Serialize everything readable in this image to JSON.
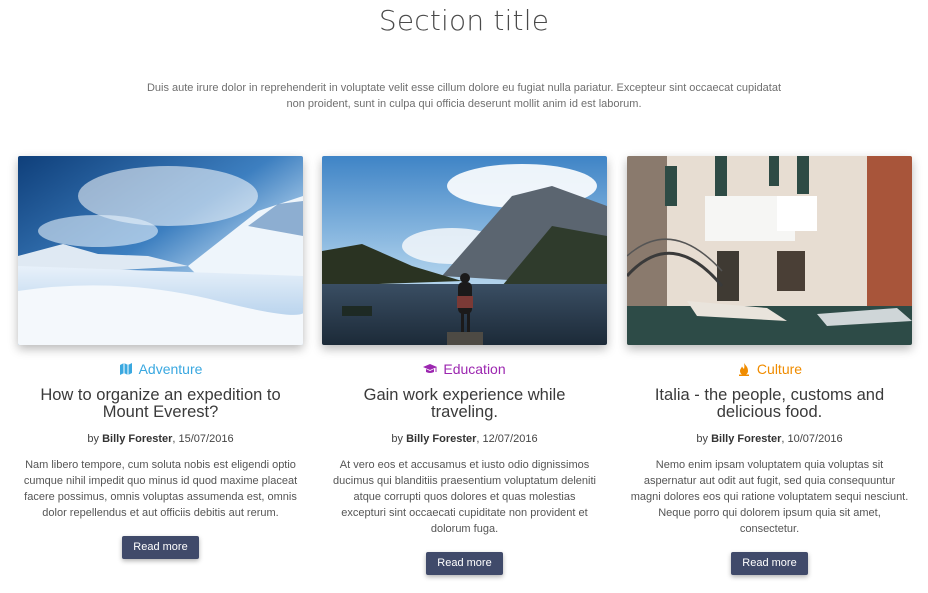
{
  "section": {
    "title": "Section title",
    "intro": "Duis aute irure dolor in reprehenderit in voluptate velit esse cillum dolore eu fugiat nulla pariatur. Excepteur sint occaecat cupidatat non proident, sunt in culpa qui officia deserunt mollit anim id est laborum."
  },
  "colors": {
    "adventure": "#3aa8e0",
    "education": "#9c27b0",
    "culture": "#f08c00",
    "button": "#404a6a"
  },
  "cards": [
    {
      "category": "Adventure",
      "category_icon": "map-icon",
      "title": "How to organize an expedition to Mount Everest?",
      "by": "by",
      "author": "Billy Forester",
      "date": ", 15/07/2016",
      "excerpt": "Nam libero tempore, cum soluta nobis est eligendi optio cumque nihil impedit quo minus id quod maxime placeat facere possimus, omnis voluptas assumenda est, omnis dolor repellendus et aut officiis debitis aut rerum.",
      "button": "Read more"
    },
    {
      "category": "Education",
      "category_icon": "graduation-cap-icon",
      "title": "Gain work experience while traveling.",
      "by": "by",
      "author": "Billy Forester",
      "date": ", 12/07/2016",
      "excerpt": "At vero eos et accusamus et iusto odio dignissimos ducimus qui blanditiis praesentium voluptatum deleniti atque corrupti quos dolores et quas molestias excepturi sint occaecati cupiditate non provident et dolorum fuga.",
      "button": "Read more"
    },
    {
      "category": "Culture",
      "category_icon": "fire-icon",
      "title": "Italia - the people, customs and delicious food.",
      "by": "by",
      "author": "Billy Forester",
      "date": ", 10/07/2016",
      "excerpt": "Nemo enim ipsam voluptatem quia voluptas sit aspernatur aut odit aut fugit, sed quia consequuntur magni dolores eos qui ratione voluptatem sequi nesciunt. Neque porro qui dolorem ipsum quia sit amet, consectetur.",
      "button": "Read more"
    }
  ]
}
